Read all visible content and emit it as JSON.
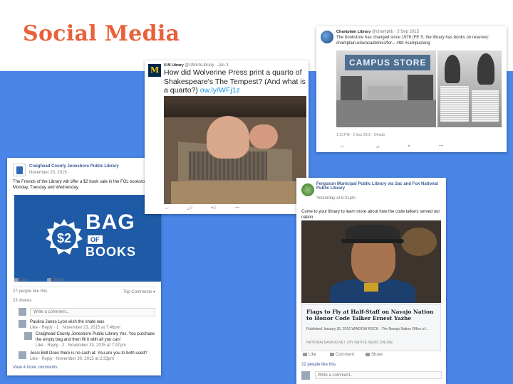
{
  "slide": {
    "title": "Social Media"
  },
  "fb_craighead": {
    "page_name": "Craighead County Jonesboro Public Library",
    "timestamp": "November 23, 2015 ·",
    "post_text": "The Friends of the Library will offer a $2 book sale in the FOL bookstore on Monday, Tuesday and Wednesday.",
    "image": {
      "badge": "$2",
      "word_bag": "BAG",
      "word_of": "OF",
      "word_books": "BOOKS"
    },
    "actions": {
      "like": "Like",
      "share": "Share"
    },
    "likes_count": "27 people like this.",
    "top_comments": "Top Comments ▾",
    "shares": "23 shares",
    "comment_placeholder": "Write a comment...",
    "comments": [
      {
        "text": "Paulina Janes Lyon wish the shate was",
        "meta": "Like · Reply · 1 · November 23, 2015 at 7:46pm"
      },
      {
        "text": "Craighead County Jonesboro Public Library Yes. You purchase the empty bag and then fill it with all you can!",
        "meta": "Like · Reply · 2 · November 23, 2015 at 7:47pm"
      },
      {
        "text": "Jessi Bell Does there is no sash at. You are you to both used?",
        "meta": "Like · Reply · November 30, 2015 at 2:33pm"
      }
    ],
    "view_more": "View 4 more comments"
  },
  "tw_um": {
    "account": "U-M Library",
    "handle": "@UMichLibrary · Jan 3",
    "tweet_text": "How did Wolverine Press print a quarto of Shakespeare's The Tempest? (And what is a quarto?) ",
    "tweet_link": "ow.ly/WFj1z",
    "retweets": "3",
    "likes": "3"
  },
  "tw_champlain": {
    "account": "Champlain Library",
    "handle": "@champlib · 3 Sep 2015",
    "tweet_text": "The bookstore has changed since 1976 (FE S, the library has books on reserve): champlain.edu/academics/for... #tbt #campuslang",
    "store_sign": "CAMPUS STORE",
    "time": "1:13 PM - 3 Sep 2015 · Details"
  },
  "fb_ferguson": {
    "page_name": "Ferguson Municipal Public Library via Sac and Fox National Public Library",
    "timestamp": "Yesterday at 6:31pm ·",
    "post_text": "Come to your library to learn more about how the code talkers served our nation",
    "link_title": "Flags to Fly at Half-Staff on Navajo Nation to Honor Code Talker Ernest Yazhe",
    "link_desc": "Published January 16, 2016 WINDOW ROCK - The Navajo Nation Office of...",
    "link_source": "NATIONALNAVAJO.NET | BY NATIVE NEWS ONLINE",
    "actions": {
      "like": "Like",
      "comment": "Comment",
      "share": "Share"
    },
    "likes_count": "22 people like this.",
    "comment_placeholder": "Write a comment..."
  },
  "colors": {
    "title_accent": "#e8613a",
    "slide_blue": "#4a86e8",
    "facebook_blue": "#3b5998",
    "twitter_link": "#1b95e0"
  }
}
